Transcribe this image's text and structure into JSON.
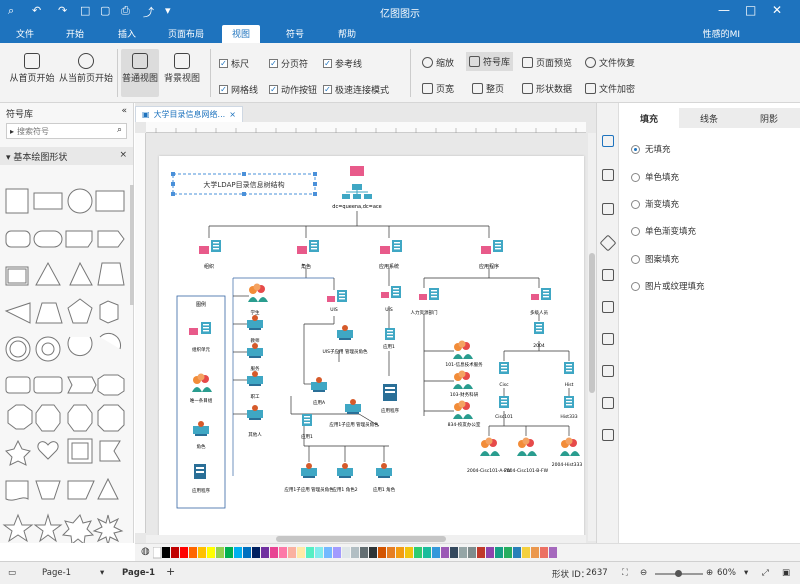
{
  "app": {
    "title": "亿图图示",
    "quick_access": [
      "⌕",
      "↶",
      "↷",
      "□",
      "▢",
      "⎙",
      "⤴",
      "▾"
    ],
    "user": "性感的MI",
    "window_buttons": [
      "—",
      "□",
      "✕"
    ]
  },
  "menu": {
    "tabs": [
      "文件",
      "开始",
      "插入",
      "页面布局",
      "视图",
      "符号",
      "帮助"
    ],
    "active": "视图"
  },
  "ribbon": {
    "present_from_first": "从首页开始",
    "present_from_current": "从当前页开始",
    "normal_view": "普通视图",
    "background_view": "背景视图",
    "ruler": "标尺",
    "page_break": "分页符",
    "reference_line": "参考线",
    "grid": "网格线",
    "action_button": "动作按钮",
    "fast_connect": "极速连接模式",
    "zoom": "缩放",
    "symbol_lib": "符号库",
    "page_preview": "页面预览",
    "file_recovery": "文件恢复",
    "page_width": "页宽",
    "whole_page": "整页",
    "shape_data": "形状数据",
    "file_encrypt": "文件加密"
  },
  "left_panel": {
    "header": "符号库",
    "search_placeholder": "搜索符号",
    "section": "基本绘图形状"
  },
  "document": {
    "tab_label": "大学目录信息网络..."
  },
  "diagram": {
    "title_box": "大学LDAP目录信息树结构",
    "root": "dc=queena,dc=ace",
    "level1": [
      "组织",
      "角色",
      "应用系统",
      "应用程序"
    ],
    "legend_title": "图例",
    "legend_items": [
      "组织单元",
      "唯一条目组",
      "角色",
      "应用程序"
    ],
    "roles": [
      "学生",
      "教师",
      "服务",
      "职工",
      "其他人"
    ],
    "ou_labels": [
      "UIS",
      "UIS"
    ],
    "uis_detail": "UIS子应用 管理员角色",
    "app_a": "应用A",
    "app_b": "应用1",
    "app_entry": "应用程序",
    "app_sub": "应用1子应用 管理员角色",
    "app_role": "应用1",
    "role_group": [
      "应用1子应用 管理员角色",
      "应用1 角色2",
      "应用1 角色"
    ],
    "person_dept": "人力资源部门",
    "mgmt": "多级人员",
    "depts": [
      "101-信息技术服务",
      "103-财务科研",
      "834-校友办公室"
    ],
    "year": "2004",
    "courses": [
      "Cisc",
      "Hist",
      "Cisc101",
      "Hist333"
    ],
    "course_groups": [
      "2004-Cisc101-A-FW",
      "2004-Cisc101-B-FW",
      "2004-Hist333"
    ]
  },
  "right_panel": {
    "tabs": [
      "填充",
      "线条",
      "阴影"
    ],
    "active_tab": "填充",
    "options": [
      "无填充",
      "单色填充",
      "渐变填充",
      "单色渐变填充",
      "图案填充",
      "图片或纹理填充"
    ],
    "selected": "无填充"
  },
  "statusbar": {
    "page_left": "Page-1",
    "page_tab": "Page-1",
    "add": "+",
    "shape_id_label": "形状 ID：",
    "shape_id": "2637",
    "zoom": "60%"
  },
  "colors": {
    "accent": "#1e73be",
    "pink": "#e85a8a",
    "teal": "#3fa7c4"
  }
}
